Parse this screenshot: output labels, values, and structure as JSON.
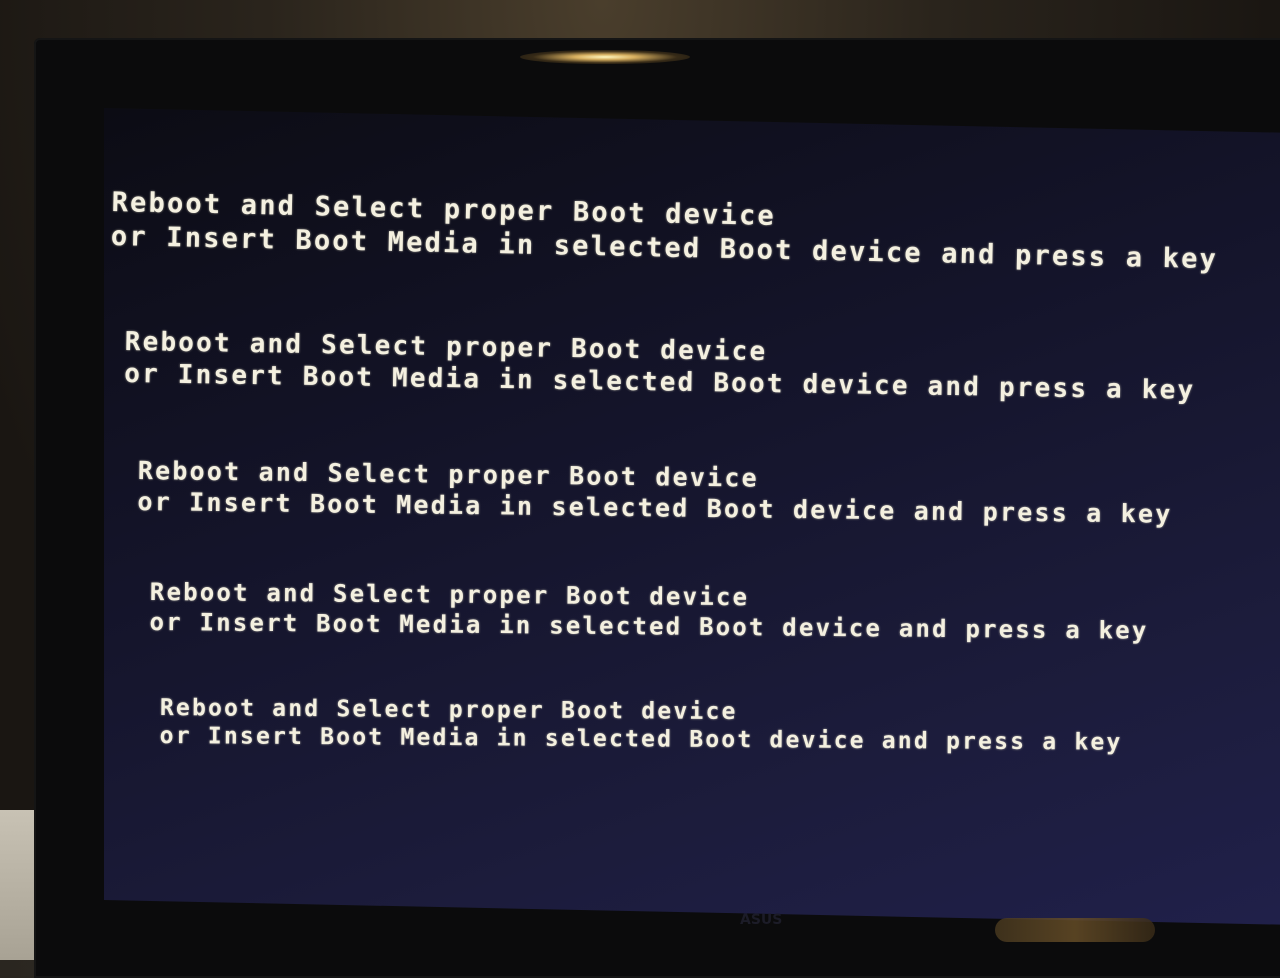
{
  "scene": "Photo of a monitor displaying a BIOS boot error message repeated five times",
  "messages": [
    {
      "line1": "Reboot and Select proper Boot device",
      "line2": "or Insert Boot Media in selected Boot device and press a key"
    },
    {
      "line1": "Reboot and Select proper Boot device",
      "line2": "or Insert Boot Media in selected Boot device and press a key"
    },
    {
      "line1": "Reboot and Select proper Boot device",
      "line2": "or Insert Boot Media in selected Boot device and press a key"
    },
    {
      "line1": "Reboot and Select proper Boot device",
      "line2": "or Insert Boot Media in selected Boot device and press a key"
    },
    {
      "line1": "Reboot and Select proper Boot device",
      "line2": "or Insert Boot Media in selected Boot device and press a key"
    }
  ],
  "monitor_brand": "ASUS",
  "colors": {
    "text": "#f4f0e0",
    "screen": "#1a1a38",
    "bezel": "#0b0b0c"
  }
}
